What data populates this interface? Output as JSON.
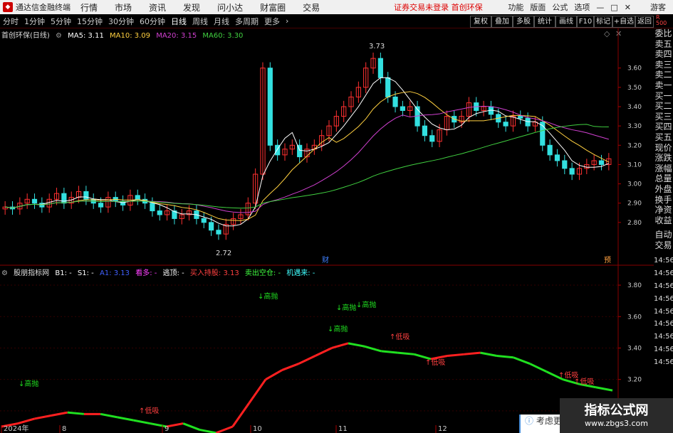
{
  "app": {
    "title": "通达信金融终端",
    "notice": "证券交易未登录 首创环保"
  },
  "top_menu": [
    "行情",
    "市场",
    "资讯",
    "发现",
    "问小达",
    "财富圈",
    "交易"
  ],
  "top_right": [
    "功能",
    "版面",
    "公式",
    "选项"
  ],
  "guest": "游客",
  "timeframes": [
    "分时",
    "1分钟",
    "5分钟",
    "15分钟",
    "30分钟",
    "60分钟",
    "日线",
    "周线",
    "月线",
    "多周期",
    "更多"
  ],
  "active_timeframe": "日线",
  "right_buttons": [
    "复权",
    "叠加",
    "多股",
    "统计",
    "画线",
    "F10",
    "标记",
    "+自选",
    "返回"
  ],
  "main_legend": {
    "title": "首创环保(日线)",
    "ma5": "MA5: 3.11",
    "ma10": "MA10: 3.09",
    "ma20": "MA20: 3.15",
    "ma60": "MA60: 3.30"
  },
  "sub_legend": {
    "title": "股朋指标网",
    "b1": "B1: -",
    "s1": "S1: -",
    "a1": "A1: 3.13",
    "kan": "看多: -",
    "tao": "逃顶: -",
    "buy": "买入持股: 3.13",
    "sell": "卖出空仓: -",
    "chance": "机遇来: -"
  },
  "side_panel": [
    "委比",
    "卖五",
    "卖四",
    "卖三",
    "卖二",
    "卖一",
    "买一",
    "买二",
    "买三",
    "买四",
    "买五",
    "现价",
    "涨跌",
    "涨幅",
    "总量",
    "外盘",
    "换手",
    "净资",
    "收益",
    "自动",
    "交易"
  ],
  "right_axis_main": [
    "3.60",
    "3.50",
    "3.40",
    "3.30",
    "3.20",
    "3.10",
    "3.00",
    "2.90",
    "2.80"
  ],
  "right_axis_sub": [
    "3.80",
    "3.60",
    "3.40",
    "3.20",
    "3.00"
  ],
  "sub_side_times": [
    "14:56",
    "14:56",
    "14:56",
    "14:56",
    "14:56",
    "14:56",
    "14:56",
    "14:56",
    "14:56"
  ],
  "x_labels": [
    "2024年",
    "8",
    "9",
    "10",
    "11",
    "12"
  ],
  "annotations": {
    "high": "3.73",
    "low": "2.72",
    "cai": "财",
    "yu": "预",
    "gaopao": "高抛",
    "dixi": "低吸"
  },
  "popup": "考虑更",
  "watermark": {
    "line1": "指标公式网",
    "line2": "www.zbgs3.com"
  },
  "colors": {
    "up": "#ff3030",
    "down": "#33e0e0",
    "ma5": "#ffffff",
    "ma10": "#ffd040",
    "ma20": "#d040d0",
    "ma60": "#40d040"
  },
  "chart_data": [
    {
      "type": "candlestick",
      "title": "首创环保(日线)",
      "ylim": [
        2.7,
        3.75
      ],
      "y_ticks": [
        2.8,
        2.9,
        3.0,
        3.1,
        3.2,
        3.3,
        3.4,
        3.5,
        3.6
      ],
      "x_labels": [
        "2024年",
        "8",
        "9",
        "10",
        "11",
        "12"
      ],
      "series_ma": [
        "MA5",
        "MA10",
        "MA20",
        "MA60"
      ],
      "high_mark": 3.73,
      "low_mark": 2.72,
      "close_approx": [
        2.88,
        2.87,
        2.9,
        2.92,
        2.9,
        2.88,
        2.92,
        2.95,
        2.9,
        2.93,
        2.96,
        2.92,
        2.9,
        2.88,
        2.93,
        2.91,
        2.89,
        2.94,
        2.92,
        2.9,
        2.86,
        2.84,
        2.86,
        2.82,
        2.84,
        2.86,
        2.82,
        2.8,
        2.76,
        2.74,
        2.79,
        2.82,
        2.84,
        2.9,
        3.05,
        3.6,
        3.2,
        3.15,
        3.18,
        3.2,
        3.14,
        3.18,
        3.2,
        3.25,
        3.3,
        3.35,
        3.4,
        3.45,
        3.5,
        3.6,
        3.65,
        3.55,
        3.45,
        3.4,
        3.38,
        3.4,
        3.3,
        3.25,
        3.22,
        3.28,
        3.35,
        3.32,
        3.35,
        3.42,
        3.38,
        3.4,
        3.36,
        3.32,
        3.3,
        3.35,
        3.34,
        3.3,
        3.32,
        3.2,
        3.15,
        3.12,
        3.08,
        3.05,
        3.08,
        3.1,
        3.12,
        3.1,
        3.13
      ]
    },
    {
      "type": "line",
      "title": "股朋指标网",
      "ylim": [
        2.9,
        3.85
      ],
      "y_ticks": [
        3.0,
        3.2,
        3.4,
        3.6,
        3.8
      ],
      "values_approx": [
        2.9,
        2.92,
        2.95,
        2.97,
        2.99,
        2.98,
        2.98,
        2.96,
        2.94,
        2.92,
        2.9,
        2.92,
        2.88,
        2.86,
        2.9,
        3.05,
        3.2,
        3.26,
        3.3,
        3.35,
        3.4,
        3.43,
        3.41,
        3.38,
        3.37,
        3.36,
        3.33,
        3.35,
        3.36,
        3.37,
        3.35,
        3.34,
        3.3,
        3.25,
        3.2,
        3.17,
        3.15,
        3.13
      ]
    }
  ]
}
